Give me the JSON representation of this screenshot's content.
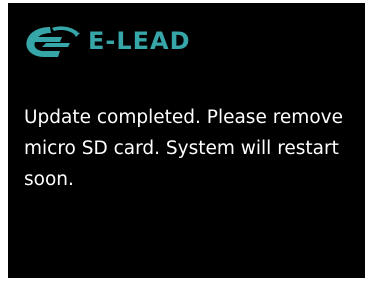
{
  "brand": {
    "name": "E-LEAD",
    "logo_icon": "e-lead-swoosh-logo-icon",
    "color": "#37a6a8"
  },
  "screen": {
    "background": "#000000",
    "message": "Update completed. Please remove micro SD card. System will restart soon."
  }
}
